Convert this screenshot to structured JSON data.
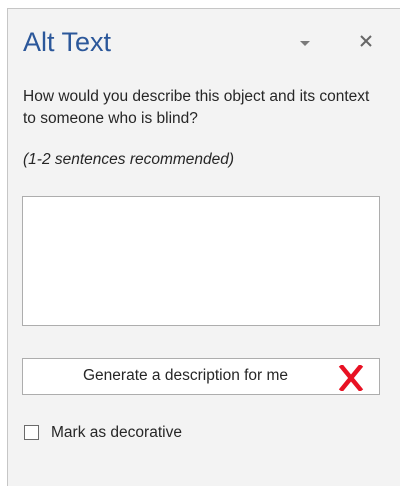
{
  "pane": {
    "title": "Alt Text",
    "prompt": "How would you describe this object and its context to someone who is blind?",
    "hint": "(1-2 sentences recommended)",
    "alt_text_value": "",
    "generate_label": "Generate a description for me",
    "decorative_label": "Mark as decorative",
    "decorative_checked": false
  },
  "icons": {
    "pane_options": "chevron-down-icon",
    "close": "close-icon",
    "generate_marker": "red-x-icon"
  },
  "colors": {
    "title": "#2b579a",
    "marker": "#e81123"
  }
}
